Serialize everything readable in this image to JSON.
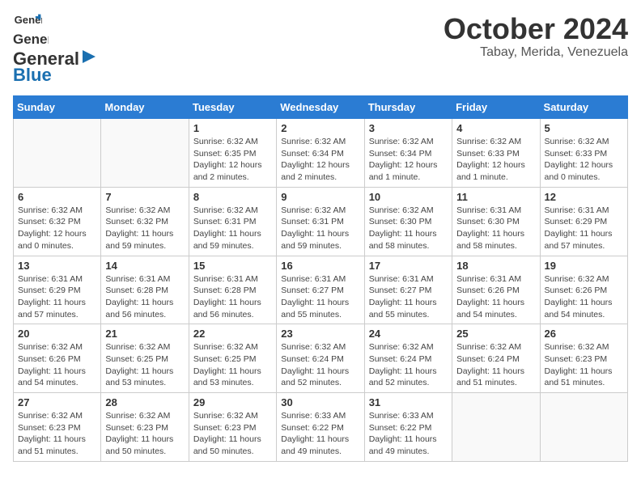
{
  "header": {
    "logo_general": "General",
    "logo_blue": "Blue",
    "month": "October 2024",
    "location": "Tabay, Merida, Venezuela"
  },
  "weekdays": [
    "Sunday",
    "Monday",
    "Tuesday",
    "Wednesday",
    "Thursday",
    "Friday",
    "Saturday"
  ],
  "weeks": [
    [
      {
        "day": "",
        "info": ""
      },
      {
        "day": "",
        "info": ""
      },
      {
        "day": "1",
        "info": "Sunrise: 6:32 AM\nSunset: 6:35 PM\nDaylight: 12 hours\nand 2 minutes."
      },
      {
        "day": "2",
        "info": "Sunrise: 6:32 AM\nSunset: 6:34 PM\nDaylight: 12 hours\nand 2 minutes."
      },
      {
        "day": "3",
        "info": "Sunrise: 6:32 AM\nSunset: 6:34 PM\nDaylight: 12 hours\nand 1 minute."
      },
      {
        "day": "4",
        "info": "Sunrise: 6:32 AM\nSunset: 6:33 PM\nDaylight: 12 hours\nand 1 minute."
      },
      {
        "day": "5",
        "info": "Sunrise: 6:32 AM\nSunset: 6:33 PM\nDaylight: 12 hours\nand 0 minutes."
      }
    ],
    [
      {
        "day": "6",
        "info": "Sunrise: 6:32 AM\nSunset: 6:32 PM\nDaylight: 12 hours\nand 0 minutes."
      },
      {
        "day": "7",
        "info": "Sunrise: 6:32 AM\nSunset: 6:32 PM\nDaylight: 11 hours\nand 59 minutes."
      },
      {
        "day": "8",
        "info": "Sunrise: 6:32 AM\nSunset: 6:31 PM\nDaylight: 11 hours\nand 59 minutes."
      },
      {
        "day": "9",
        "info": "Sunrise: 6:32 AM\nSunset: 6:31 PM\nDaylight: 11 hours\nand 59 minutes."
      },
      {
        "day": "10",
        "info": "Sunrise: 6:32 AM\nSunset: 6:30 PM\nDaylight: 11 hours\nand 58 minutes."
      },
      {
        "day": "11",
        "info": "Sunrise: 6:31 AM\nSunset: 6:30 PM\nDaylight: 11 hours\nand 58 minutes."
      },
      {
        "day": "12",
        "info": "Sunrise: 6:31 AM\nSunset: 6:29 PM\nDaylight: 11 hours\nand 57 minutes."
      }
    ],
    [
      {
        "day": "13",
        "info": "Sunrise: 6:31 AM\nSunset: 6:29 PM\nDaylight: 11 hours\nand 57 minutes."
      },
      {
        "day": "14",
        "info": "Sunrise: 6:31 AM\nSunset: 6:28 PM\nDaylight: 11 hours\nand 56 minutes."
      },
      {
        "day": "15",
        "info": "Sunrise: 6:31 AM\nSunset: 6:28 PM\nDaylight: 11 hours\nand 56 minutes."
      },
      {
        "day": "16",
        "info": "Sunrise: 6:31 AM\nSunset: 6:27 PM\nDaylight: 11 hours\nand 55 minutes."
      },
      {
        "day": "17",
        "info": "Sunrise: 6:31 AM\nSunset: 6:27 PM\nDaylight: 11 hours\nand 55 minutes."
      },
      {
        "day": "18",
        "info": "Sunrise: 6:31 AM\nSunset: 6:26 PM\nDaylight: 11 hours\nand 54 minutes."
      },
      {
        "day": "19",
        "info": "Sunrise: 6:32 AM\nSunset: 6:26 PM\nDaylight: 11 hours\nand 54 minutes."
      }
    ],
    [
      {
        "day": "20",
        "info": "Sunrise: 6:32 AM\nSunset: 6:26 PM\nDaylight: 11 hours\nand 54 minutes."
      },
      {
        "day": "21",
        "info": "Sunrise: 6:32 AM\nSunset: 6:25 PM\nDaylight: 11 hours\nand 53 minutes."
      },
      {
        "day": "22",
        "info": "Sunrise: 6:32 AM\nSunset: 6:25 PM\nDaylight: 11 hours\nand 53 minutes."
      },
      {
        "day": "23",
        "info": "Sunrise: 6:32 AM\nSunset: 6:24 PM\nDaylight: 11 hours\nand 52 minutes."
      },
      {
        "day": "24",
        "info": "Sunrise: 6:32 AM\nSunset: 6:24 PM\nDaylight: 11 hours\nand 52 minutes."
      },
      {
        "day": "25",
        "info": "Sunrise: 6:32 AM\nSunset: 6:24 PM\nDaylight: 11 hours\nand 51 minutes."
      },
      {
        "day": "26",
        "info": "Sunrise: 6:32 AM\nSunset: 6:23 PM\nDaylight: 11 hours\nand 51 minutes."
      }
    ],
    [
      {
        "day": "27",
        "info": "Sunrise: 6:32 AM\nSunset: 6:23 PM\nDaylight: 11 hours\nand 51 minutes."
      },
      {
        "day": "28",
        "info": "Sunrise: 6:32 AM\nSunset: 6:23 PM\nDaylight: 11 hours\nand 50 minutes."
      },
      {
        "day": "29",
        "info": "Sunrise: 6:32 AM\nSunset: 6:23 PM\nDaylight: 11 hours\nand 50 minutes."
      },
      {
        "day": "30",
        "info": "Sunrise: 6:33 AM\nSunset: 6:22 PM\nDaylight: 11 hours\nand 49 minutes."
      },
      {
        "day": "31",
        "info": "Sunrise: 6:33 AM\nSunset: 6:22 PM\nDaylight: 11 hours\nand 49 minutes."
      },
      {
        "day": "",
        "info": ""
      },
      {
        "day": "",
        "info": ""
      }
    ]
  ]
}
